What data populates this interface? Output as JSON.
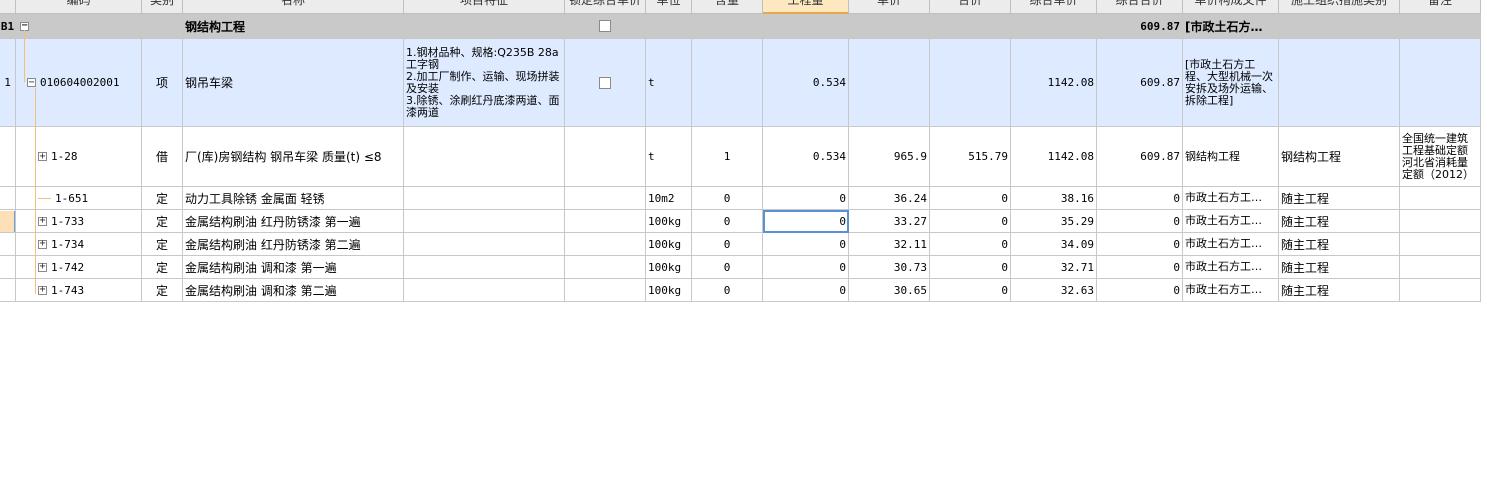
{
  "columns": [
    {
      "key": "idx",
      "label": ""
    },
    {
      "key": "code",
      "label": "编码"
    },
    {
      "key": "type",
      "label": "类别"
    },
    {
      "key": "name",
      "label": "名称"
    },
    {
      "key": "feature",
      "label": "项目特征"
    },
    {
      "key": "lock",
      "label": "锁定综合单价"
    },
    {
      "key": "unit",
      "label": "单位"
    },
    {
      "key": "content",
      "label": "含量"
    },
    {
      "key": "qty",
      "label": "工程量"
    },
    {
      "key": "price",
      "label": "单价"
    },
    {
      "key": "total",
      "label": "合价"
    },
    {
      "key": "comp_price",
      "label": "综合单价"
    },
    {
      "key": "comp_total",
      "label": "综合合价"
    },
    {
      "key": "doc",
      "label": "单价构成文件"
    },
    {
      "key": "measure",
      "label": "施工组织措施类别"
    },
    {
      "key": "remark",
      "label": "备注"
    }
  ],
  "rows": [
    {
      "kind": "group",
      "idx": "B1",
      "toggle": "−",
      "code": "",
      "type": "",
      "name": "钢结构工程",
      "feature": "",
      "lock": true,
      "unit": "",
      "content": "",
      "qty": "",
      "price": "",
      "total": "",
      "comp_price": "",
      "comp_total": "609.87",
      "doc": "[市政土石方…",
      "measure": "",
      "remark": ""
    },
    {
      "kind": "item",
      "idx": "1",
      "toggle": "−",
      "code": "010604002001",
      "type": "项",
      "name": "钢吊车梁",
      "feature": "1.钢材品种、规格:Q235B 28a工字钢\n2.加工厂制作、运输、现场拼装及安装\n3.除锈、涂刷红丹底漆两道、面漆两道",
      "lock": true,
      "unit": "t",
      "content": "",
      "qty": "0.534",
      "price": "",
      "total": "",
      "comp_price": "1142.08",
      "comp_total": "609.87",
      "doc": "[市政土石方工程、大型机械一次安拆及场外运输、拆除工程]",
      "measure": "",
      "remark": ""
    },
    {
      "kind": "sub",
      "idx": "",
      "toggle": "+",
      "code": "1-28",
      "type": "借",
      "name": "厂(库)房钢结构 钢吊车梁 质量(t) ≤8",
      "feature": "",
      "lock": false,
      "unit": "t",
      "content": "1",
      "qty": "0.534",
      "price": "965.9",
      "total": "515.79",
      "comp_price": "1142.08",
      "comp_total": "609.87",
      "doc": "钢结构工程",
      "measure": "钢结构工程",
      "remark": "全国统一建筑工程基础定额河北省消耗量定额（2012）"
    },
    {
      "kind": "sub",
      "idx": "",
      "toggle": "",
      "code": "1-651",
      "type": "定",
      "name": "动力工具除锈 金属面 轻锈",
      "feature": "",
      "lock": false,
      "unit": "10m2",
      "content": "0",
      "qty": "0",
      "price": "36.24",
      "total": "0",
      "comp_price": "38.16",
      "comp_total": "0",
      "doc": "市政土石方工…",
      "measure": "随主工程",
      "remark": ""
    },
    {
      "kind": "sub",
      "idx": "",
      "toggle": "+",
      "code": "1-733",
      "type": "定",
      "name": "金属结构刷油 红丹防锈漆 第一遍",
      "feature": "",
      "lock": false,
      "unit": "100kg",
      "content": "0",
      "qty": "0",
      "price": "33.27",
      "total": "0",
      "comp_price": "35.29",
      "comp_total": "0",
      "doc": "市政土石方工…",
      "measure": "随主工程",
      "remark": ""
    },
    {
      "kind": "sub",
      "idx": "",
      "toggle": "+",
      "code": "1-734",
      "type": "定",
      "name": "金属结构刷油 红丹防锈漆 第二遍",
      "feature": "",
      "lock": false,
      "unit": "100kg",
      "content": "0",
      "qty": "0",
      "price": "32.11",
      "total": "0",
      "comp_price": "34.09",
      "comp_total": "0",
      "doc": "市政土石方工…",
      "measure": "随主工程",
      "remark": ""
    },
    {
      "kind": "sub",
      "idx": "",
      "toggle": "+",
      "code": "1-742",
      "type": "定",
      "name": "金属结构刷油 调和漆 第一遍",
      "feature": "",
      "lock": false,
      "unit": "100kg",
      "content": "0",
      "qty": "0",
      "price": "30.73",
      "total": "0",
      "comp_price": "32.71",
      "comp_total": "0",
      "doc": "市政土石方工…",
      "measure": "随主工程",
      "remark": ""
    },
    {
      "kind": "sub",
      "idx": "",
      "toggle": "+",
      "code": "1-743",
      "type": "定",
      "name": "金属结构刷油 调和漆 第二遍",
      "feature": "",
      "lock": false,
      "unit": "100kg",
      "content": "0",
      "qty": "0",
      "price": "30.65",
      "total": "0",
      "comp_price": "32.63",
      "comp_total": "0",
      "doc": "市政土石方工…",
      "measure": "随主工程",
      "remark": ""
    }
  ]
}
